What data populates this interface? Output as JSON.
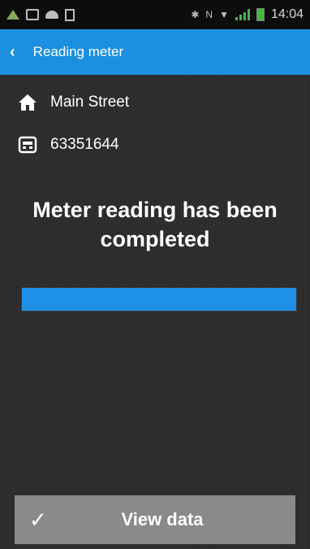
{
  "statusbar": {
    "time": "14:04",
    "icons": [
      "tree-icon",
      "image-icon",
      "cloud-icon",
      "document-icon",
      "bluetooth-icon",
      "nfc-icon",
      "wifi-icon",
      "signal-icon",
      "battery-icon"
    ],
    "nfc_text": "N"
  },
  "header": {
    "back_icon": "‹",
    "title": "Reading meter"
  },
  "info": {
    "address_icon": "house-icon",
    "address": "Main Street",
    "meter_icon": "meter-icon",
    "meter_number": "63351644"
  },
  "status": {
    "message": "Meter reading has been completed",
    "progress": 1.0
  },
  "footer": {
    "check_icon": "✓",
    "button_label": "View data"
  },
  "colors": {
    "accent": "#1b8fe0",
    "progress": "#1e90e6",
    "button": "#8a8a8a"
  }
}
